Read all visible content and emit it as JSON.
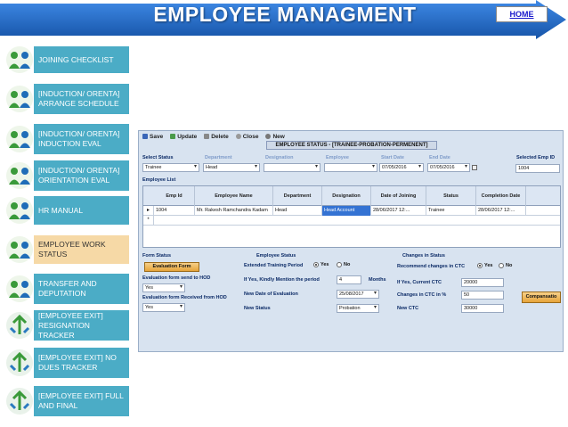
{
  "header": {
    "title": "EMPLOYEE MANAGMENT",
    "home_link": "HOME",
    "colors": {
      "banner": "#1e6fd0",
      "banner_dark": "#1654a8"
    }
  },
  "sidebar": {
    "items": [
      {
        "label": "JOINING CHECKLIST",
        "icon": "people-icon",
        "active": false
      },
      {
        "label": "[INDUCTION/ ORENTA] ARRANGE SCHEDULE",
        "icon": "people-icon",
        "active": false
      },
      {
        "label": "[INDUCTION/ ORENTA] INDUCTION EVAL",
        "icon": "people-icon",
        "active": false
      },
      {
        "label": "[INDUCTION/ ORENTA] ORIENTATION EVAL",
        "icon": "people-icon",
        "active": false
      },
      {
        "label": "HR MANUAL",
        "icon": "people-icon",
        "active": false
      },
      {
        "label": "EMPLOYEE WORK STATUS",
        "icon": "people-icon",
        "active": true
      },
      {
        "label": "TRANSFER AND DEPUTATION",
        "icon": "people-icon",
        "active": false
      },
      {
        "label": "[EMPLOYEE EXIT] RESIGNATION TRACKER",
        "icon": "arrows-icon",
        "active": false
      },
      {
        "label": "[EMPLOYEE EXIT] NO DUES TRACKER",
        "icon": "arrows-icon",
        "active": false
      },
      {
        "label": "[EMPLOYEE EXIT] FULL AND FINAL",
        "icon": "arrows-icon",
        "active": false
      }
    ],
    "colors": {
      "item": "#4bacc6",
      "active": "#f6d9a6"
    }
  },
  "app": {
    "toolbar": {
      "save": "Save",
      "update": "Update",
      "delete": "Delete",
      "close": "Close",
      "new": "New"
    },
    "status_title": "EMPLOYEE STATUS - [TRAINEE-PROBATION-PERMENENT]",
    "filters": {
      "select_status_label": "Select Status",
      "select_status_value": "Trainee",
      "department_label": "Department",
      "department_value": "Head",
      "designation_label": "Designation",
      "employee_label": "Employee",
      "start_date_label": "Start Date",
      "start_date_value": "07/05/2016",
      "end_date_label": "End Date",
      "end_date_value": "07/05/2016",
      "selected_emp_id_label": "Selected Emp ID",
      "selected_emp_id_value": "1004"
    },
    "employee_list_label": "Employee List",
    "grid": {
      "columns": [
        "Emp Id",
        "Employee Name",
        "Department",
        "Designation",
        "Date of Joining",
        "Status",
        "Completion Date"
      ],
      "rows": [
        [
          "1004",
          "Mr. Rakesh Ramchandra Kadam",
          "Head",
          "Head Account",
          "28/06/2017 12:...",
          "Trainee",
          "28/06/2017 12:..."
        ]
      ],
      "row_marker": "▸",
      "new_row_marker": "*"
    },
    "form_status": {
      "title": "Form Status",
      "evaluation_form_button": "Evaluation Form",
      "sent_to_hod_label": "Evaluation form send to HOD",
      "sent_to_hod_value": "Yes",
      "received_from_hod_label": "Evaluation form Received from HOD",
      "received_from_hod_value": "Yes"
    },
    "employee_status": {
      "title": "Employee Status",
      "extended_training_label": "Extended Training Period",
      "yes": "Yes",
      "no": "No",
      "mention_period_label": "If Yes, Kindly Mention the period",
      "period_value": "4",
      "period_unit": "Months",
      "new_eval_date_label": "New Date of Evaluation",
      "new_eval_date_value": "25/08/2017",
      "new_status_label": "New Status",
      "new_status_value": "Probation"
    },
    "changes_in_status": {
      "title": "Changes in Status",
      "recommend_label": "Recommend changes in CTC",
      "yes": "Yes",
      "no": "No",
      "current_ctc_label": "If Yes, Current CTC",
      "current_ctc_value": "20000",
      "ctc_change_label": "Changes in CTC in %",
      "ctc_change_value": "50",
      "new_ctc_label": "New CTC",
      "new_ctc_value": "30000",
      "compensation_button": "Compansatio"
    }
  }
}
